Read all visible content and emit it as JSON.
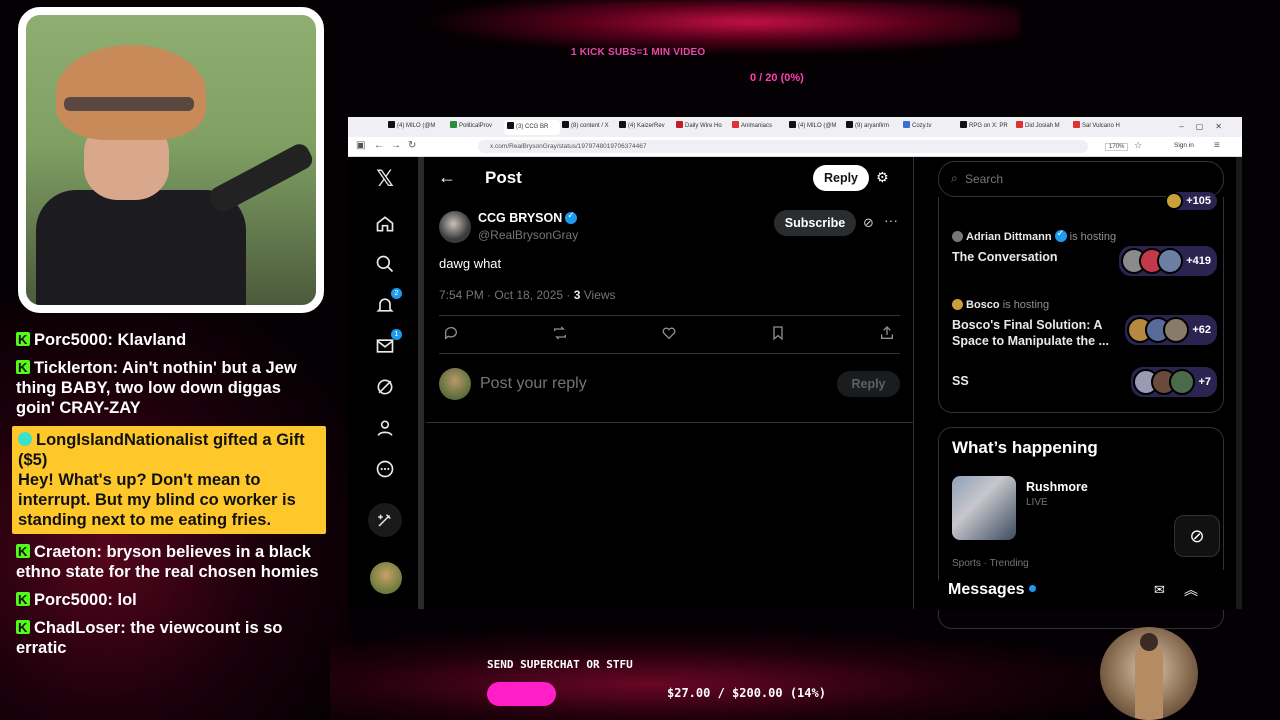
{
  "overlay": {
    "kick_goal": "1 KICK SUBS=1 MIN VIDEO",
    "kick_progress": "0 / 20 (0%)",
    "superchat_label": "SEND SUPERCHAT OR STFU",
    "superchat_progress": "$27.00 / $200.00 (14%)",
    "superchat_fraction": 0.14,
    "accent_pink": "#ff1ec7"
  },
  "chat": {
    "messages": [
      {
        "user": "Porc5000",
        "text": "Klavland"
      },
      {
        "user": "Ticklerton",
        "text": "Ain't nothin' but a Jew thing BABY, two low down diggas goin' CRAY-ZAY"
      },
      {
        "user": "LongIslandNationalist",
        "gift": "gifted a Gift ($5)",
        "text": "Hey! What's up? Don't mean to interrupt. But my blind co worker is standing next to me eating fries."
      },
      {
        "user": "Craeton",
        "text": "bryson believes in a black ethno state for the real chosen homies"
      },
      {
        "user": "Porc5000",
        "text": "lol"
      },
      {
        "user": "ChadLoser",
        "text": "the viewcount is so erratic"
      }
    ]
  },
  "browser": {
    "tabs": [
      "(4) MILO (@M",
      "PoliticalProv",
      "(3) CCG BR",
      "(8) content / X",
      "(4) KaizerRev",
      "Daily Wire Ho",
      "Animaniacs",
      "(4) MILO (@M",
      "(9) aryanfirm",
      "Cozy.tv",
      "RPG on X: PR",
      "Did Josiah M",
      "Sal Vulcano H"
    ],
    "url": "x.com/RealBrysonGray/status/1979748019706374467",
    "zoom": "170%",
    "signin": "Sign in"
  },
  "x": {
    "header_title": "Post",
    "reply_top_label": "Reply",
    "post": {
      "display_name": "CCG BRYSON",
      "handle": "@RealBrysonGray",
      "subscribe_label": "Subscribe",
      "text": "dawg what",
      "timestamp": "7:54 PM · Oct 18, 2025 · ",
      "views_count": "3",
      "views_label": " Views"
    },
    "reply_placeholder": "Post your reply",
    "reply_button": "Reply",
    "nav_badges": {
      "notifications": "2",
      "messages": "1"
    },
    "search_placeholder": "Search",
    "spaces": [
      {
        "host": "",
        "host_suffix": "",
        "title": "",
        "listeners": "+105"
      },
      {
        "host": "Adrian Dittmann",
        "host_suffix": "is hosting",
        "title": "The Conversation",
        "listeners": "+419"
      },
      {
        "host": "Bosco",
        "host_suffix": "is hosting",
        "title": "Bosco's Final Solution: A Space to Manipulate the ...",
        "listeners": "+62"
      },
      {
        "host": "",
        "host_suffix": "",
        "title": "SS",
        "listeners": "+7"
      }
    ],
    "happening_title": "What’s happening",
    "trend": {
      "name": "Rushmore",
      "status": "LIVE",
      "sub": "Sports · Trending"
    },
    "messages_label": "Messages",
    "brand_blue": "#1d9bf0"
  }
}
